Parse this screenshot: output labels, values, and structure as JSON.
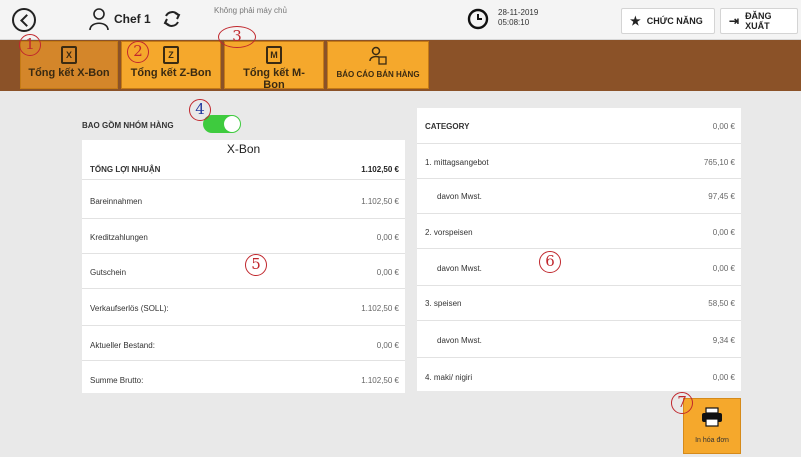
{
  "topbar": {
    "user_name": "Chef 1",
    "server_status": "Không phải máy chủ",
    "date": "28-11-2019",
    "time": "05:08:10",
    "functions_label": "CHỨC NĂNG",
    "logout_label": "ĐĂNG XUẤT"
  },
  "tabs": [
    {
      "label": "Tổng kết X-Bon",
      "icon": "x-doc-icon",
      "doc_letter": "X",
      "active": true
    },
    {
      "label": "Tổng kết Z-Bon",
      "icon": "z-doc-icon",
      "doc_letter": "Z",
      "active": false
    },
    {
      "label": "Tổng kết M-Bon",
      "icon": "m-doc-icon",
      "doc_letter": "M",
      "active": false
    },
    {
      "label": "BÁO CÁO BÁN HÀNG",
      "icon": "user-report-icon",
      "active": false
    }
  ],
  "markers": [
    "1",
    "2",
    "3",
    "4",
    "5",
    "6",
    "7"
  ],
  "left": {
    "include_groups_label": "BAO GỒM NHÓM HÀNG",
    "include_groups_on": true,
    "title": "X-Bon",
    "total": {
      "label": "TỔNG LỢI NHUẬN",
      "value": "1.102,50 €"
    },
    "rows": [
      {
        "label": "Bareinnahmen",
        "value": "1.102,50 €"
      },
      {
        "label": "Kreditzahlungen",
        "value": "0,00 €"
      },
      {
        "label": "Gutschein",
        "value": "0,00 €"
      },
      {
        "label": "Verkaufserlös (SOLL):",
        "value": "1.102,50 €"
      },
      {
        "label": "Aktueller Bestand:",
        "value": "0,00 €"
      },
      {
        "label": "Summe Brutto:",
        "value": "1.102,50 €"
      }
    ]
  },
  "right": {
    "rows": [
      {
        "label": "CATEGORY",
        "value": "0,00 €",
        "bold": true
      },
      {
        "label": "1. mittagsangebot",
        "value": "765,10 €"
      },
      {
        "label": "davon Mwst.",
        "value": "97,45 €",
        "sub": true
      },
      {
        "label": "2. vorspeisen",
        "value": "0,00 €"
      },
      {
        "label": "davon Mwst.",
        "value": "0,00 €",
        "sub": true
      },
      {
        "label": "3. speisen",
        "value": "58,50 €"
      },
      {
        "label": "davon Mwst.",
        "value": "9,34 €",
        "sub": true
      },
      {
        "label": "4. maki/ nigiri",
        "value": "0,00 €"
      }
    ]
  },
  "print_label": "In hóa đơn",
  "colors": {
    "tab_bg": "#f5a82c",
    "tab_bar": "#8b5228",
    "toggle_on": "#3ecb3e",
    "marker": "#c0272d"
  }
}
